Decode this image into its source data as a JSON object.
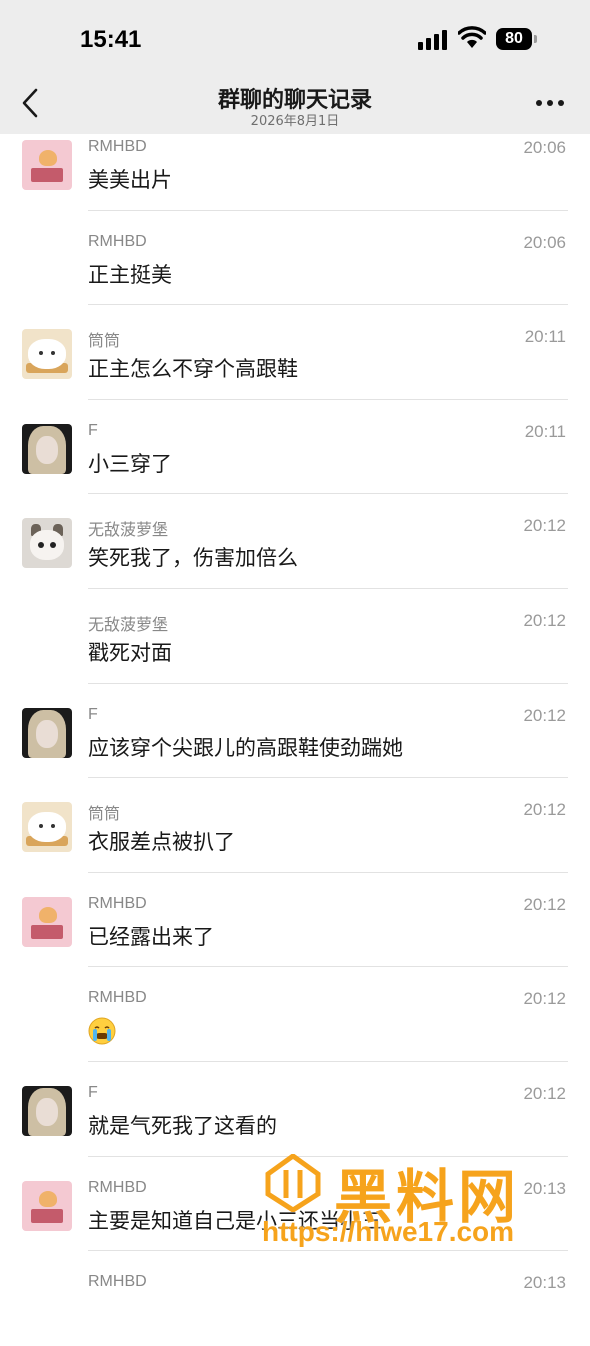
{
  "status_bar": {
    "time": "15:41",
    "battery": "80"
  },
  "nav": {
    "title": "群聊的聊天记录",
    "subtitle": "2026年8月1日"
  },
  "messages": [
    {
      "sender": "RMHBD",
      "time": "20:06",
      "text": "美美出片",
      "avatar": "avatar-rmhbd"
    },
    {
      "sender": "RMHBD",
      "time": "20:06",
      "text": "正主挺美",
      "avatar": ""
    },
    {
      "sender": "筒筒",
      "time": "20:11",
      "text": "正主怎么不穿个高跟鞋",
      "avatar": "avatar-tongtong"
    },
    {
      "sender": "F",
      "time": "20:11",
      "text": "小三穿了",
      "avatar": "avatar-f"
    },
    {
      "sender": "无敌菠萝堡",
      "time": "20:12",
      "text": "笑死我了，伤害加倍么",
      "avatar": "avatar-cat"
    },
    {
      "sender": "无敌菠萝堡",
      "time": "20:12",
      "text": "戳死对面",
      "avatar": ""
    },
    {
      "sender": "F",
      "time": "20:12",
      "text": "应该穿个尖跟儿的高跟鞋使劲踹她",
      "avatar": "avatar-f"
    },
    {
      "sender": "筒筒",
      "time": "20:12",
      "text": "衣服差点被扒了",
      "avatar": "avatar-tongtong"
    },
    {
      "sender": "RMHBD",
      "time": "20:12",
      "text": "已经露出来了",
      "avatar": "avatar-rmhbd"
    },
    {
      "sender": "RMHBD",
      "time": "20:12",
      "text": "",
      "emoji": "crying-emoji",
      "avatar": ""
    },
    {
      "sender": "F",
      "time": "20:12",
      "text": "就是气死我了这看的",
      "avatar": "avatar-f"
    },
    {
      "sender": "RMHBD",
      "time": "20:13",
      "text": "主要是知道自己是小三还当小三",
      "avatar": "avatar-rmhbd"
    },
    {
      "sender": "RMHBD",
      "time": "20:13",
      "text": "",
      "avatar": ""
    }
  ],
  "watermark": {
    "title": "黑料网",
    "url": "https://hlwe17.com"
  }
}
